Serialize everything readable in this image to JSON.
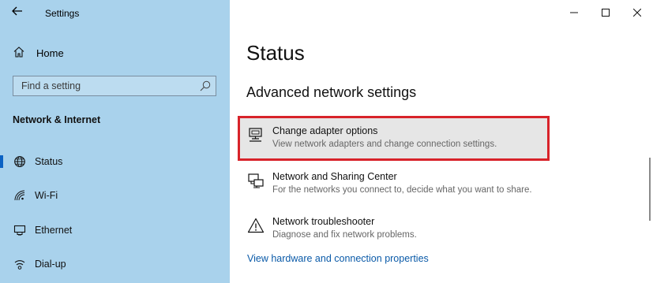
{
  "window": {
    "title": "Settings",
    "controls": {
      "minimize": "–",
      "maximize": "□",
      "close": "✕"
    }
  },
  "sidebar": {
    "home_label": "Home",
    "search_placeholder": "Find a setting",
    "section_header": "Network & Internet",
    "items": [
      {
        "label": "Status",
        "icon": "globe-icon",
        "selected": true
      },
      {
        "label": "Wi-Fi",
        "icon": "wifi-icon",
        "selected": false
      },
      {
        "label": "Ethernet",
        "icon": "ethernet-icon",
        "selected": false
      },
      {
        "label": "Dial-up",
        "icon": "dialup-icon",
        "selected": false
      }
    ]
  },
  "main": {
    "title": "Status",
    "subtitle": "Advanced network settings",
    "options": [
      {
        "title": "Change adapter options",
        "desc": "View network adapters and change connection settings.",
        "icon": "adapter-icon",
        "highlighted": true
      },
      {
        "title": "Network and Sharing Center",
        "desc": "For the networks you connect to, decide what you want to share.",
        "icon": "sharing-center-icon",
        "highlighted": false
      },
      {
        "title": "Network troubleshooter",
        "desc": "Diagnose and fix network problems.",
        "icon": "warning-icon",
        "highlighted": false
      }
    ],
    "link": "View hardware and connection properties"
  },
  "colors": {
    "sidebar_bg": "#a9d2ec",
    "accent": "#0b62c4",
    "highlight_border": "#d8232a",
    "link": "#0a5aa8"
  }
}
